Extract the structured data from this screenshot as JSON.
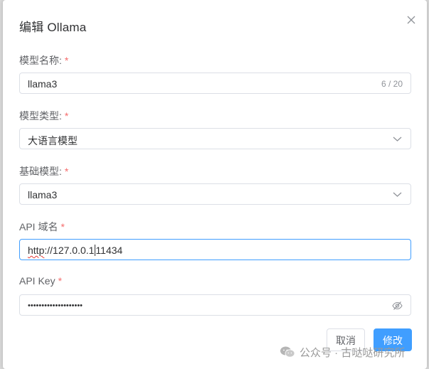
{
  "dialog": {
    "title": "编辑 Ollama"
  },
  "fields": {
    "model_name": {
      "label": "模型名称:",
      "required_mark": "*",
      "value": "llama3",
      "counter": "6 / 20"
    },
    "model_type": {
      "label": "模型类型:",
      "required_mark": "*",
      "value": "大语言模型"
    },
    "base_model": {
      "label": "基础模型:",
      "required_mark": "*",
      "value": "llama3"
    },
    "api_domain": {
      "label": "API 域名",
      "required_mark": "*",
      "value_before_caret": "http",
      "value_mid": "://127.0.0.1",
      "value_after_caret": "11434"
    },
    "api_key": {
      "label": "API Key",
      "required_mark": "*",
      "masked_value": "••••••••••••••••••••"
    }
  },
  "buttons": {
    "cancel": "取消",
    "confirm": "修改"
  },
  "watermark": {
    "text": "公众号 · 古哒哒研究所"
  },
  "icons": {
    "close": "close-icon",
    "chevron": "chevron-down-icon",
    "eye": "eye-off-icon",
    "watermark": "wechat-icon"
  },
  "colors": {
    "primary": "#409eff",
    "required": "#f56c6c",
    "border": "#dcdfe6",
    "label": "#606266"
  }
}
